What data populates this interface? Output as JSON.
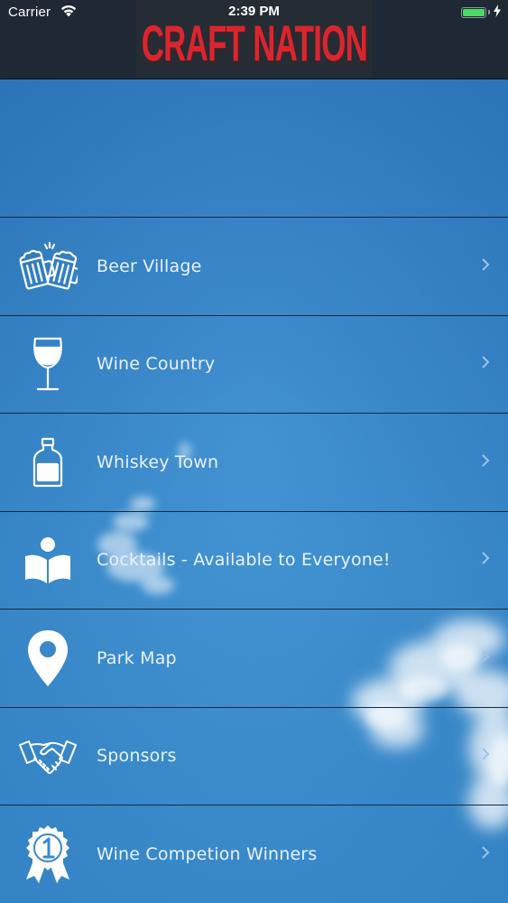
{
  "status_bar": {
    "carrier": "Carrier",
    "time": "2:39 PM",
    "wifi_icon": "wifi-icon",
    "battery_color": "#4cd964",
    "battery_level": 1.0
  },
  "header": {
    "logo_text": "CRAFT NATION",
    "logo_color": "#d9262e"
  },
  "menu": {
    "items": [
      {
        "label": "Beer Village",
        "icon": "beer-mugs-icon"
      },
      {
        "label": "Wine Country",
        "icon": "wine-glass-icon"
      },
      {
        "label": "Whiskey Town",
        "icon": "whiskey-bottle-icon"
      },
      {
        "label": "Cocktails - Available to Everyone!",
        "icon": "reader-book-icon"
      },
      {
        "label": "Park Map",
        "icon": "map-pin-icon"
      },
      {
        "label": "Sponsors",
        "icon": "handshake-icon"
      },
      {
        "label": "Wine Competion Winners",
        "icon": "award-ribbon-icon"
      }
    ]
  },
  "colors": {
    "sky_top": "#2f79bf",
    "sky_bottom": "#3c92d4",
    "nav_bg": "#1f2935",
    "text": "#eaf2fb"
  }
}
